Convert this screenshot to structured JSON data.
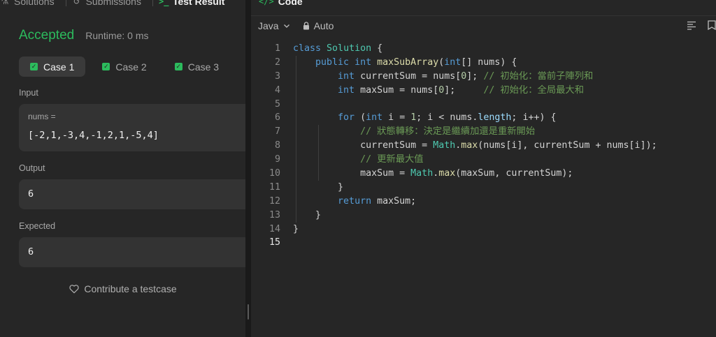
{
  "left_panel": {
    "tabs": [
      {
        "label": "Solutions",
        "icon": "flask-icon"
      },
      {
        "label": "Submissions",
        "icon": "history-icon"
      },
      {
        "label": "Test Result",
        "icon": "terminal-icon"
      }
    ],
    "result_title": "Accepted",
    "runtime": "Runtime: 0 ms",
    "cases": [
      "Case 1",
      "Case 2",
      "Case 3"
    ],
    "input_label": "Input",
    "input_var": "nums =",
    "input_value": "[-2,1,-3,4,-1,2,1,-5,4]",
    "output_label": "Output",
    "output_value": "6",
    "expected_label": "Expected",
    "expected_value": "6",
    "contribute_label": "Contribute a testcase"
  },
  "code_panel": {
    "title": "Code",
    "title_icon": "</>",
    "language": "Java",
    "mode": "Auto"
  },
  "code_lines": [
    "class Solution {",
    "    public int maxSubArray(int[] nums) {",
    "        int currentSum = nums[0]; // 初始化：當前子陣列和",
    "        int maxSum = nums[0];     // 初始化：全局最大和",
    "",
    "        for (int i = 1; i < nums.length; i++) {",
    "            // 狀態轉移：決定是繼續加還是重新開始",
    "            currentSum = Math.max(nums[i], currentSum + nums[i]);",
    "            // 更新最大值",
    "            maxSum = Math.max(maxSum, currentSum);",
    "        }",
    "        return maxSum;",
    "    }",
    "}",
    ""
  ],
  "colors": {
    "accent_green": "#2cbb5d",
    "keyword": "#569cd6",
    "type": "#4ec9b0",
    "function": "#dcdcaa",
    "number": "#b5cea8",
    "comment": "#6a9955"
  }
}
